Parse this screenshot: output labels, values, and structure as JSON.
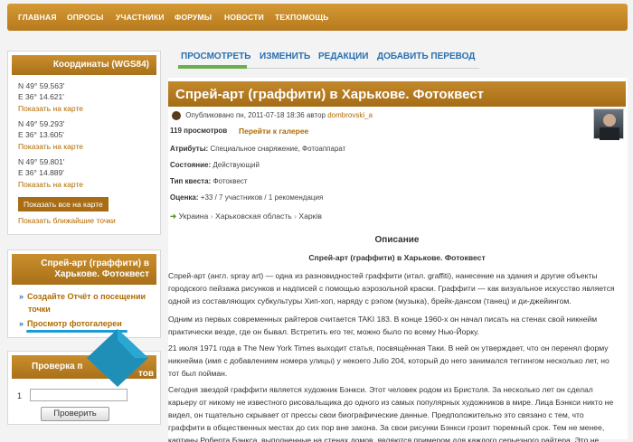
{
  "topnav": [
    "ГЛАВНАЯ",
    "ОПРОСЫ",
    "УЧАСТНИКИ",
    "ФОРУМЫ",
    "НОВОСТИ",
    "ТЕХПОМОЩЬ"
  ],
  "coords": {
    "title": "Координаты (WGS84)",
    "points": [
      {
        "lat": "N 49° 59.563'",
        "lon": "E 36° 14.621'",
        "link": "Показать на карте"
      },
      {
        "lat": "N 49° 59.293'",
        "lon": "E 36° 13.605'",
        "link": "Показать на карте"
      },
      {
        "lat": "N 49° 59.801'",
        "lon": "E 36° 14.889'",
        "link": "Показать на карте"
      }
    ],
    "show_all": "Показать все на карте",
    "show_nearest": "Показать ближайшие точки"
  },
  "quest_box": {
    "title1": "Спрей-арт (граффити) в",
    "title2": "Харькове. Фотоквест",
    "link1a": "Создайте Отчёт о посещении",
    "link1b": "точки",
    "link2": "Просмотр фотогалереи"
  },
  "check_box": {
    "title1": "Проверка п",
    "title2": "тов",
    "index": "1",
    "button": "Проверить"
  },
  "tabs": [
    "ПРОСМОТРЕТЬ",
    "ИЗМЕНИТЬ",
    "РЕДАКЦИИ",
    "ДОБАВИТЬ ПЕРЕВОД"
  ],
  "page": {
    "title": "Спрей-арт (граффити) в Харькове. Фотоквест",
    "published": "Опубликовано пн, 2011-07-18 18:36 автор",
    "author": "dombrovski_a",
    "views": "119 просмотров",
    "gallery_link": "Перейти к галерее",
    "attr_label": "Атрибуты:",
    "attr_value": "Специальное снаряжение, Фотоаппарат",
    "state_label": "Состояние:",
    "state_value": "Действующий",
    "type_label": "Тип квеста:",
    "type_value": "Фотоквест",
    "rating_label": "Оценка:",
    "rating_value": "+33 / 7 участников / 1 рекомендация",
    "breadcrumb": [
      "Украина",
      "Харьковская область",
      "Харків"
    ],
    "desc_heading": "Описание",
    "desc_subheading": "Спрей-арт (граффити) в Харькове. Фотоквест",
    "p1_lines": [
      "Спрей-арт (англ. spray art) — одна из разновидностей граффити (итал. graffiti), нанесение на здания и другие объекты",
      "городского пейзажа рисунков и надписей с помощью аэрозольной краски. Граффити — как визуальное искусство является",
      "одной из составляющих субкультуры Хип-хоп, наряду с рэпом (музыка), брейк-дансом (танец) и ди-джейингом."
    ],
    "p2_lines": [
      "Одним из первых современных райтеров считается TAKI 183. В конце 1960-х он начал писать на стенах свой никнейм",
      "практически везде, где он бывал. Встретить его тег, можно было по всему Нью-Йорку."
    ],
    "p3_lines": [
      "21 июля 1971 года в The New York Times выходит статья, посвящённая Таки. В ней он утверждает, что он перенял форму",
      "никнейма (имя с добавлением номера улицы) у некоего Julio 204, который до него занимался теггингом несколько лет, но",
      "тот был пойман."
    ],
    "p4_lines": [
      "Сегодня звездой граффити является художник Бэнкси. Этот человек родом из Бристоля. За несколько лет он сделал",
      "карьеру от никому не известного рисовальщика до одного из самых популярных художников в мире. Лица Бэнкси никто не",
      "видел, он тщательно скрывает от прессы свои биографические данные. Предположительно это связано с тем, что",
      "граффити в общественных местах до сих пор вне закона. За свои рисунки Бэнкси грозит тюремный срок. Тем не менее,",
      "картины Роберта Бэнкса, выполненные на стенах домов, являются примером для каждого серьезного райтера. Это не"
    ]
  },
  "colors": {
    "accent": "#b6791d",
    "link": "#2a6fb0",
    "highlight": "#1a9bd7"
  }
}
